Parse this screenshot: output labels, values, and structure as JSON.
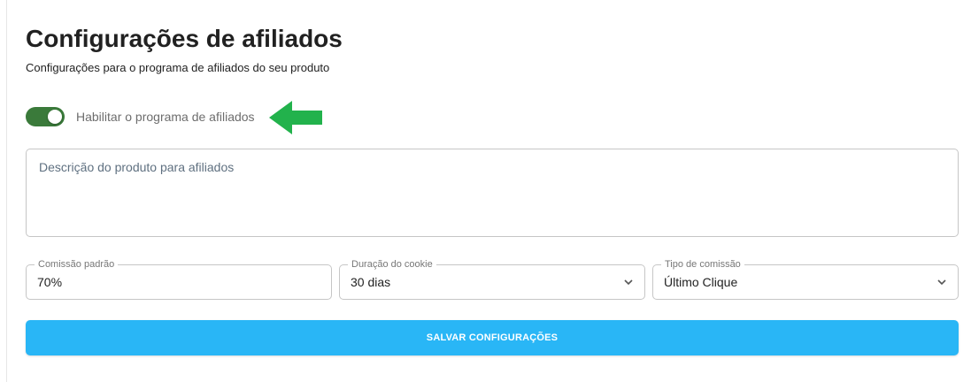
{
  "header": {
    "title": "Configurações de afiliados",
    "subtitle": "Configurações para o programa de afiliados do seu produto"
  },
  "toggle": {
    "label": "Habilitar o programa de afiliados",
    "enabled": true
  },
  "description": {
    "placeholder": "Descrição do produto para afiliados"
  },
  "fields": {
    "commission": {
      "legend": "Comissão padrão",
      "value": "70%"
    },
    "cookie": {
      "legend": "Duração do cookie",
      "value": "30 dias"
    },
    "type": {
      "legend": "Tipo de comissão",
      "value": "Último Clique"
    }
  },
  "save_button": {
    "label": "SALVAR CONFIGURAÇÕES"
  },
  "colors": {
    "accent": "#29b6f6",
    "toggle_on": "#3a7a3a",
    "arrow": "#22b24c"
  },
  "icons": {
    "dropdown": "chevron-down-icon",
    "pointer": "arrow-left-icon"
  }
}
